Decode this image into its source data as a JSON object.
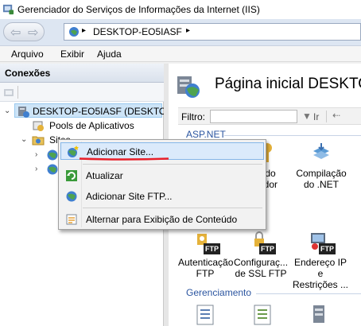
{
  "window": {
    "title": "Gerenciador do Serviços de Informações da Internet (IIS)"
  },
  "address": {
    "host": "DESKTOP-EO5IASF",
    "sep": "▸"
  },
  "menu": {
    "items": [
      "Arquivo",
      "Exibir",
      "Ajuda"
    ]
  },
  "connections": {
    "header": "Conexões",
    "server": "DESKTOP-EO5IASF (DESKTOP",
    "app_pools": "Pools de Aplicativos",
    "sites": "Sites"
  },
  "main": {
    "title": "Página inicial DESKTO",
    "filter_label": "Filtro:",
    "go_label": "Ir",
    "group_aspnet": "ASP.NET",
    "group_mgmt": "Gerenciamento",
    "features_row1": [
      {
        "label1": "ve do",
        "label2": "utador"
      },
      {
        "label1": "Compilação",
        "label2": "do .NET"
      }
    ],
    "features_row2": [
      {
        "label1": "Autenticação",
        "label2": "FTP"
      },
      {
        "label1": "Configuraç...",
        "label2": "de SSL FTP"
      },
      {
        "label1": "Endereço IP e",
        "label2": "Restrições ..."
      }
    ],
    "ftp_badge": "FTP"
  },
  "context_menu": {
    "items": [
      {
        "label": "Adicionar Site..."
      },
      {
        "label": "Atualizar"
      },
      {
        "label": "Adicionar Site FTP..."
      },
      {
        "label": "Alternar para Exibição de Conteúdo"
      }
    ]
  },
  "colors": {
    "highlight": "#dbeafb",
    "annotation": "#e8202a",
    "group_header": "#2b55a0"
  }
}
